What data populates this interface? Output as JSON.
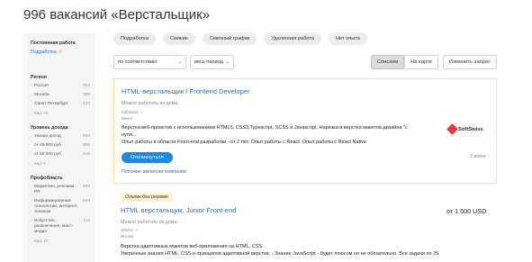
{
  "page": {
    "title": "996 вакансий «Верстальщик»"
  },
  "chips": [
    "Подработка",
    "Свежие",
    "Сменный график",
    "Удаленная работа",
    "Нет опыта"
  ],
  "sidebar": {
    "top_group_title": "Постоянная работа",
    "top_item": "Подработка",
    "top_item_icon": "lightning-icon",
    "region": {
      "title": "Регион",
      "items": [
        {
          "label": "Россия",
          "count": "902"
        },
        {
          "label": "Москва",
          "count": "398"
        },
        {
          "label": "Санкт-Петербург",
          "count": "120"
        }
      ],
      "more": "Ещё 93"
    },
    "income": {
      "title": "Уровень дохода",
      "items": [
        {
          "label": "Указан доход",
          "count": "660"
        },
        {
          "label": "от 45 000 руб",
          "count": "555"
        },
        {
          "label": "от 60 000 руб",
          "count": "245"
        }
      ],
      "more": "Ещё 5"
    },
    "prof": {
      "title": "Профобласть",
      "items": [
        {
          "label": "Маркетинг, реклама,\nPR",
          "count": "586"
        },
        {
          "label": "Информационные\nтехнологии, интернет,\nтелеком",
          "count": "533"
        },
        {
          "label": "Искусство,\nразвлечения, масс-\nмедиа",
          "count": "116"
        }
      ],
      "more": "Ещё 17"
    }
  },
  "filters": {
    "sort_value": "по соответствию",
    "period_value": "весь период",
    "btn_list": "Списком",
    "btn_map": "На карте",
    "btn_change": "Изменить запрос"
  },
  "vacancies": [
    {
      "title": "HTML-верстальщик / Frontend Developer",
      "mode": "Можно работать из дома",
      "company": "SoftSwiss",
      "city": "Минск",
      "desc": "Верстка веб-проектов с использованием HTML5, CSS3,Typescript, SCSS и Javascript. Нарезка и верстка макетов дизайна \"с\nнуля...\nОпыт работы в области Front-end разработки - от 2 лет. Опыт работы с React. Опыт работы с React Native.",
      "respond": "Откликнуться",
      "similar": "Похожие вакансии компании",
      "date": "2 июня",
      "logo_text": "SoftSwiss",
      "logo_color": "#e53935"
    },
    {
      "badge": "Отклик без резюме",
      "title": "HTML верстальщик, Junior Front-end",
      "salary": "от 1 500 USD",
      "mode": "Можно работать из дома",
      "company": "SFERA",
      "city": "Москва",
      "desc": "Верстка адаптивных макетов веб-приложения на HTML, CSS.\nУверенные знания HTML, CSS и принципов адаптивной верстки. - Знание JavaScript - будет плюсом но не обязательно. Все задачи по JS"
    }
  ],
  "colors": {
    "link": "#1e6fd9",
    "button": "#1e88e5",
    "highlight_border": "#f2e49a",
    "badge_bg": "#fdf3cf"
  }
}
